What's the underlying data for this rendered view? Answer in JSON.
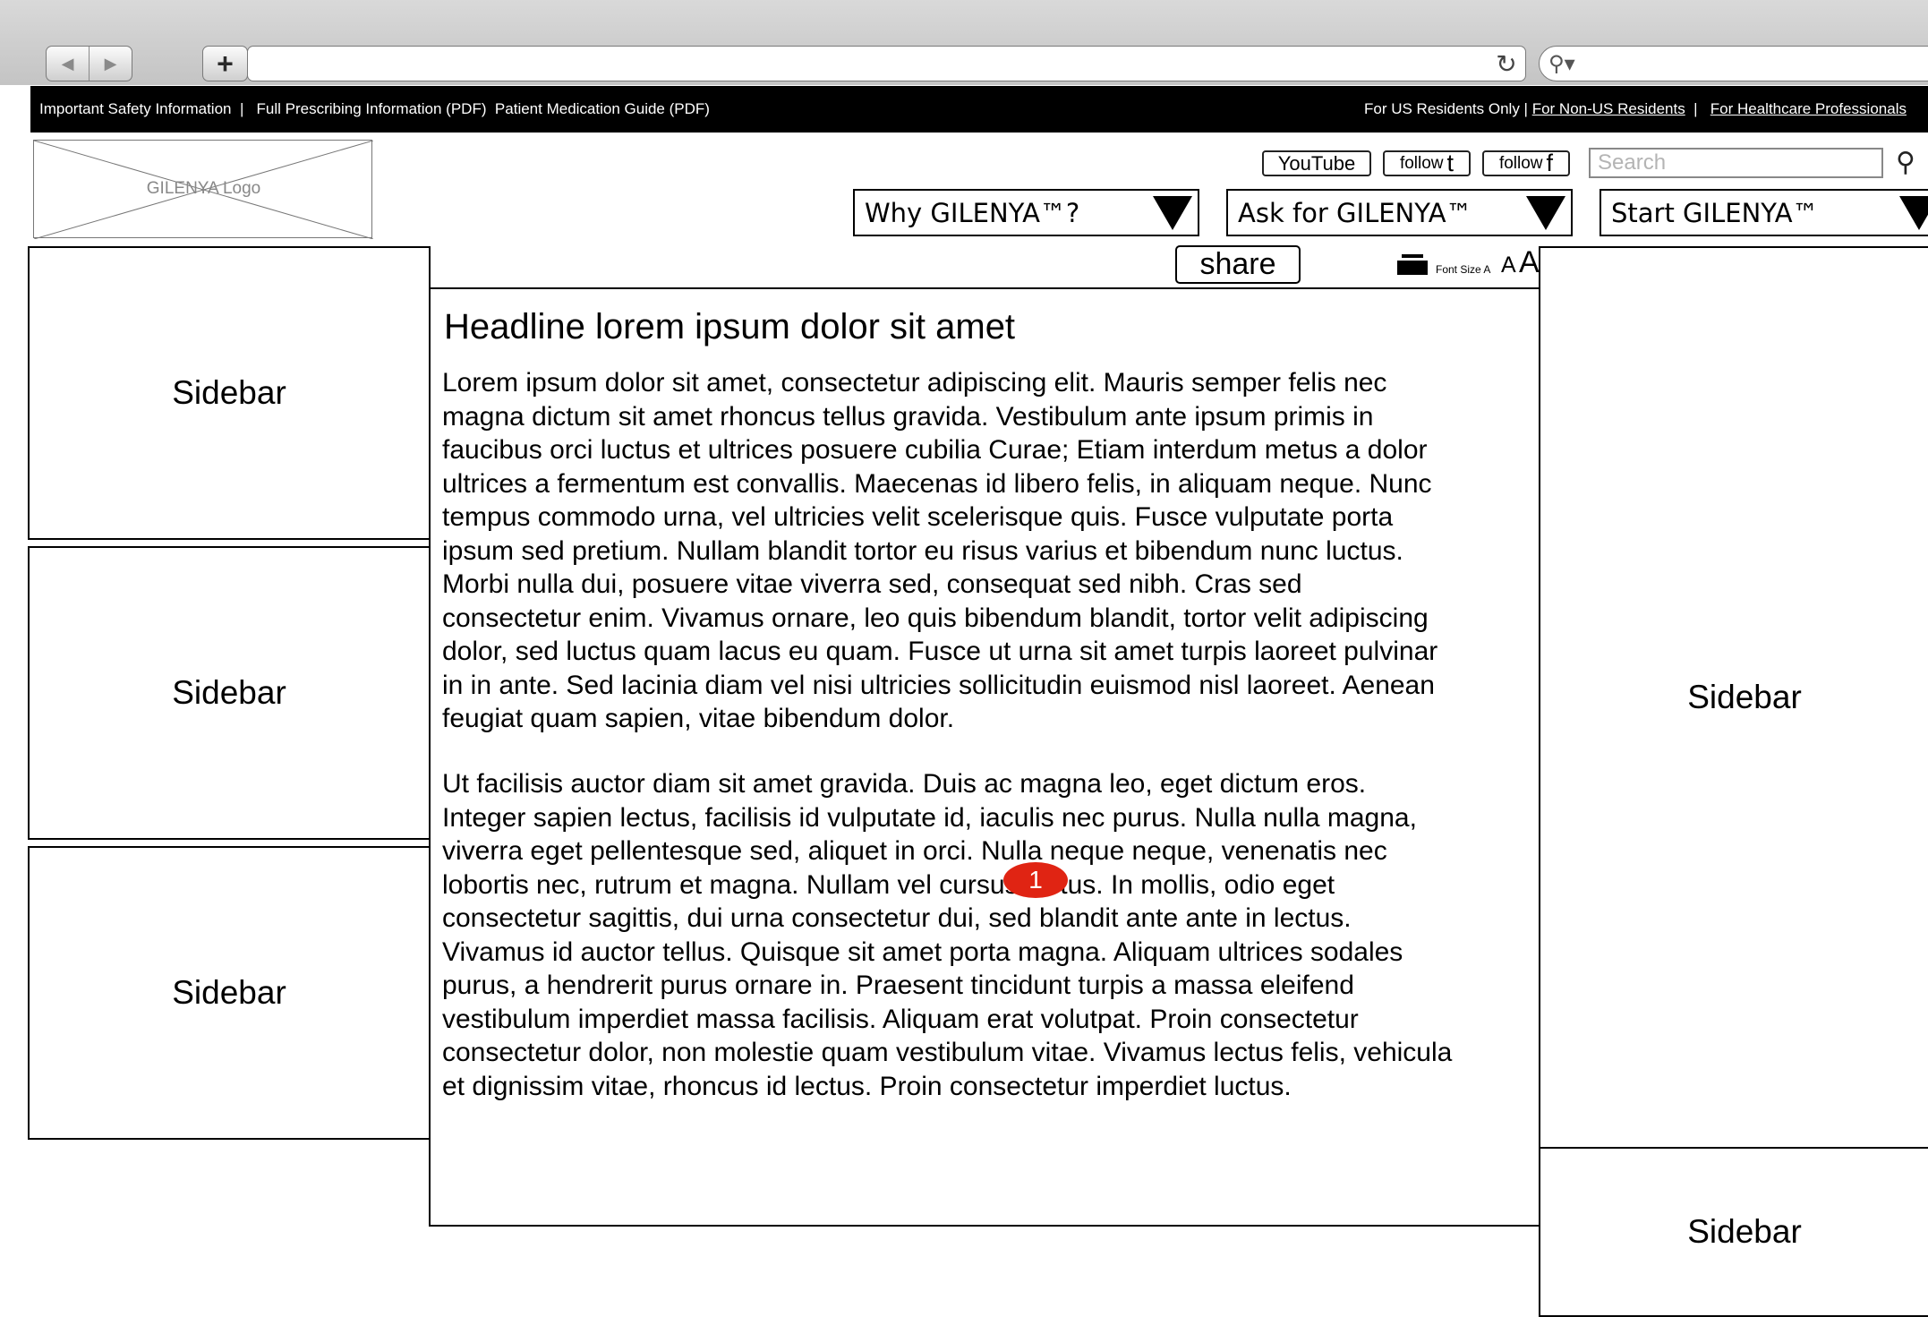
{
  "browser": {
    "add_tab": "+",
    "back_icon": "back-arrow-icon",
    "forward_icon": "forward-arrow-icon",
    "reload_icon": "reload-icon",
    "search_icon": "magnifier-icon"
  },
  "utility_bar": {
    "left_text": "Important Safety Information  |   Full Prescribing Information (PDF)  Patient Medication Guide (PDF)",
    "residents_label": "For US Residents Only | ",
    "non_us_link": "For Non-US Residents",
    "separator": "  |   ",
    "hcp_link": "For Healthcare Professionals"
  },
  "header": {
    "logo_label": "GILENYA Logo",
    "social": {
      "youtube": "YouTube",
      "follow": "follow",
      "twitter_glyph": "t",
      "facebook_glyph": "f"
    },
    "search_placeholder": "Search",
    "nav": [
      {
        "label": "Why GILENYA™?"
      },
      {
        "label": "Ask for GILENYA™"
      },
      {
        "label": "Start GILENYA™"
      }
    ]
  },
  "tools": {
    "share": "share",
    "font_size_label": "Font Size A",
    "font_a_mid": "A",
    "font_a_large": "A"
  },
  "sidebars": {
    "left": [
      "Sidebar",
      "Sidebar",
      "Sidebar"
    ],
    "right": [
      "Sidebar",
      "Sidebar"
    ]
  },
  "content": {
    "headline": "Headline lorem ipsum dolor sit amet",
    "paragraph1": "Lorem ipsum dolor sit amet, consectetur adipiscing elit. Mauris semper felis nec\nmagna dictum sit amet rhoncus tellus gravida. Vestibulum ante ipsum primis in\nfaucibus orci luctus et ultrices posuere cubilia Curae; Etiam interdum metus a dolor\nultrices a fermentum est convallis. Maecenas id libero felis, in aliquam neque. Nunc\ntempus commodo urna, vel ultricies velit scelerisque quis. Fusce vulputate porta\nipsum sed pretium. Nullam blandit tortor eu risus varius et bibendum nunc luctus.\nMorbi nulla dui, posuere vitae viverra sed, consequat sed nibh. Cras sed\nconsectetur enim. Vivamus ornare, leo quis bibendum blandit, tortor velit adipiscing\ndolor, sed luctus quam lacus eu quam. Fusce ut urna sit amet turpis laoreet pulvinar\nin in ante. Sed lacinia diam vel nisi ultricies sollicitudin euismod nisl laoreet. Aenean\nfeugiat quam sapien, vitae bibendum dolor.",
    "paragraph2": "Ut facilisis auctor diam sit amet gravida. Duis ac magna leo, eget dictum eros.\nInteger sapien lectus, facilisis id vulputate id, iaculis nec purus. Nulla nulla magna,\nviverra eget pellentesque sed, aliquet in orci. Nulla neque neque, venenatis nec\nlobortis nec, rutrum et magna. Nullam vel cursus lectus. In mollis, odio eget\nconsectetur sagittis, dui urna consectetur dui, sed blandit ante ante in lectus.\nVivamus id auctor tellus. Quisque sit amet porta magna. Aliquam ultrices sodales\npurus, a hendrerit purus ornare in. Praesent tincidunt turpis a massa eleifend\nvestibulum imperdiet massa facilisis. Aliquam erat volutpat. Proin consectetur\nconsectetur dolor, non molestie quam vestibulum vitae. Vivamus lectus felis, vehicula\net dignissim vitae, rhoncus id lectus. Proin consectetur imperdiet luctus."
  },
  "annotation": {
    "marker": "1",
    "color": "#e02413"
  }
}
